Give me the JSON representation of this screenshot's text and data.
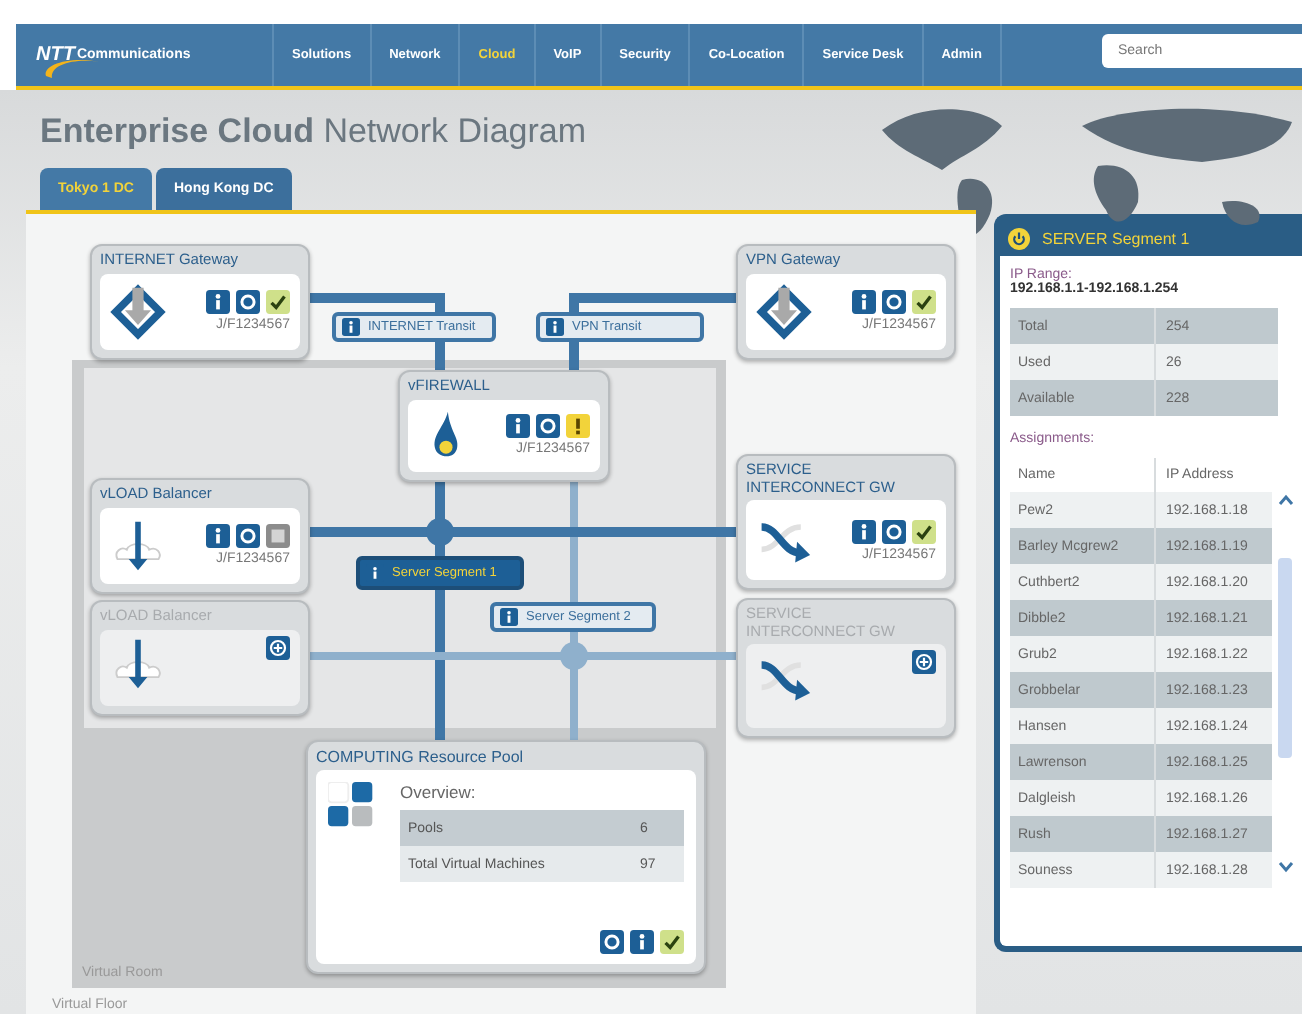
{
  "nav": {
    "logo_mark": "NTT",
    "logo_text": "Communications",
    "items": [
      {
        "label": "Solutions",
        "selected": false
      },
      {
        "label": "Network",
        "selected": false
      },
      {
        "label": "Cloud",
        "selected": true
      },
      {
        "label": "VoIP",
        "selected": false
      },
      {
        "label": "Security",
        "selected": false
      },
      {
        "label": "Co-Location",
        "selected": false
      },
      {
        "label": "Service Desk",
        "selected": false
      },
      {
        "label": "Admin",
        "selected": false
      }
    ],
    "search": {
      "placeholder": "Search"
    }
  },
  "header": {
    "title": "**Enterprise Cloud** Network Diagram",
    "tabs": [
      {
        "label": "Tokyo 1 DC",
        "selected": true
      },
      {
        "label": "Hong Kong DC",
        "selected": false
      }
    ]
  },
  "diagram": {
    "nodes": [
      {
        "title": "INTERNET Gateway",
        "kind": "gateway",
        "color": "#cfe08a",
        "code": "J/F1234567",
        "disabled": false
      },
      {
        "title": "VPN Gateway",
        "kind": "gateway",
        "color": "#cfe08a",
        "code": "J/F1234567",
        "disabled": false
      },
      {
        "title": "vFIREWALL",
        "kind": "firewall",
        "color": "#f2d33a",
        "code": "J/F1234567",
        "disabled": false
      },
      {
        "title": "vLOAD Balancer",
        "kind": "balancer",
        "color": "#8c8c8c",
        "code": "J/F1234567",
        "disabled": false
      },
      {
        "title": "SERVICE INTERCONNECT GW",
        "kind": "interconnect",
        "color": "#cfe08a",
        "code": "J/F1234567",
        "disabled": false
      },
      {
        "title": "vLOAD Balancer",
        "kind": "balancer",
        "disabled": true
      },
      {
        "title": "SERVICE INTERCONNECT GW",
        "kind": "interconnect",
        "disabled": true
      }
    ],
    "links": [
      {
        "label": "INTERNET Transit",
        "selected": false
      },
      {
        "label": "VPN Transit",
        "selected": false
      },
      {
        "label": "Server Segment 1",
        "selected": true
      },
      {
        "label": "Server Segment 2",
        "selected": false
      }
    ],
    "pool": {
      "title": "COMPUTING Resource Pool",
      "heading": "Overview:",
      "color": "#cfe08a",
      "rows": [
        {
          "label": "Pools",
          "value": "6"
        },
        {
          "label": "Total Virtual Machines",
          "value": "97"
        }
      ]
    },
    "room_label": "Virtual Room",
    "floor_label": "Virtual Floor"
  },
  "panel": {
    "title": "SERVER Segment 1",
    "range_label": "IP Range:",
    "range": "192.168.1.1-192.168.1.254",
    "stats": [
      {
        "label": "Total",
        "value": "254"
      },
      {
        "label": "Used",
        "value": "26"
      },
      {
        "label": "Available",
        "value": "228"
      }
    ],
    "assignments_label": "Assignments:",
    "columns": [
      "Name",
      "IP Address"
    ],
    "rows": [
      [
        "Pew2",
        "192.168.1.18"
      ],
      [
        "Barley Mcgrew2",
        "192.168.1.19"
      ],
      [
        "Cuthbert2",
        "192.168.1.20"
      ],
      [
        "Dibble2",
        "192.168.1.21"
      ],
      [
        "Grub2",
        "192.168.1.22"
      ],
      [
        "Grobbelar",
        "192.168.1.23"
      ],
      [
        "Hansen",
        "192.168.1.24"
      ],
      [
        "Lawrenson",
        "192.168.1.25"
      ],
      [
        "Dalgleish",
        "192.168.1.26"
      ],
      [
        "Rush",
        "192.168.1.27"
      ],
      [
        "Souness",
        "192.168.1.28"
      ]
    ]
  }
}
